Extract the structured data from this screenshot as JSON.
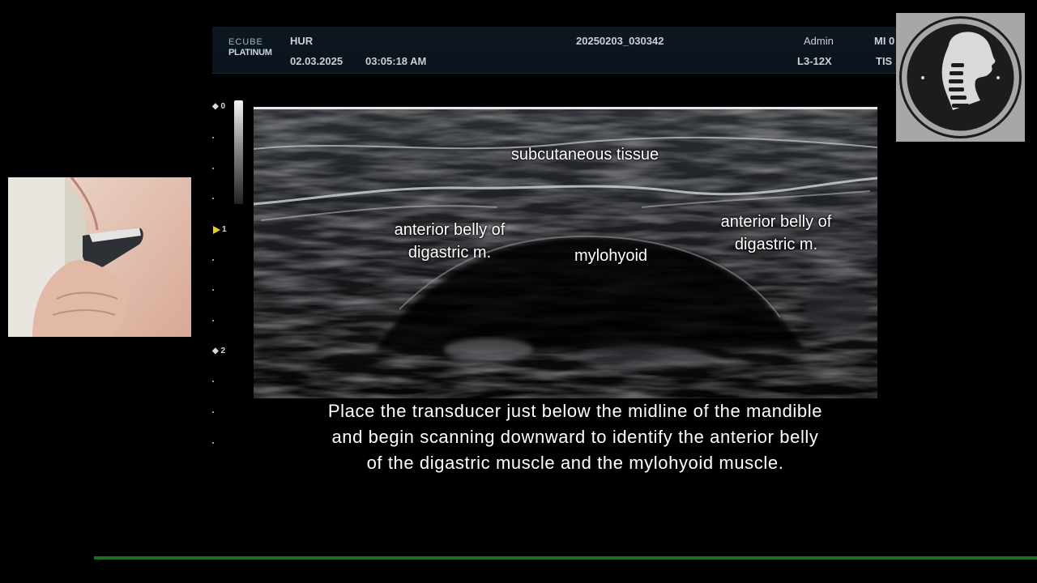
{
  "header": {
    "brand_line1": "ECUBE",
    "brand_line2": "PLATINUM",
    "patient": "HUR",
    "date": "02.03.2025",
    "time": "03:05:18  AM",
    "study_id": "20250203_030342",
    "operator": "Admin",
    "probe": "L3-12X",
    "mi_label": "MI 0",
    "tis_label": "TIS"
  },
  "depth_scale": {
    "labels": [
      "0",
      "1",
      "2"
    ]
  },
  "labels": {
    "subcutaneous": "subcutaneous tissue",
    "left_digastric_line1": "anterior belly of",
    "left_digastric_line2": "digastric m.",
    "mylohyoid": "mylohyoid",
    "right_digastric_line1": "anterior belly of",
    "right_digastric_line2": "digastric m."
  },
  "caption": {
    "line1": "Place the transducer just below the midline of the mandible",
    "line2": "and begin scanning downward to identify the anterior belly",
    "line3": "of the digastric muscle and the mylohyoid muscle."
  },
  "progress": 0.91,
  "colors": {
    "progress": "#1f6b1f",
    "focus_marker": "#e6d21a",
    "header_bg": "#0e1822"
  }
}
